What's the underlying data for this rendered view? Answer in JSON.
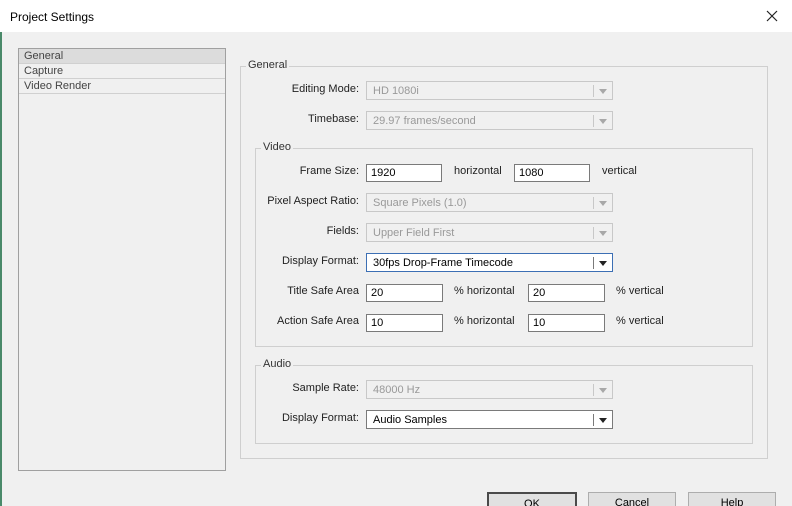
{
  "window": {
    "title": "Project Settings"
  },
  "sidebar": {
    "items": [
      {
        "label": "General"
      },
      {
        "label": "Capture"
      },
      {
        "label": "Video Render"
      }
    ]
  },
  "general": {
    "group_label": "General",
    "editing_mode": {
      "label": "Editing Mode:",
      "value": "HD 1080i"
    },
    "timebase": {
      "label": "Timebase:",
      "value": "29.97 frames/second"
    }
  },
  "video": {
    "group_label": "Video",
    "frame_size": {
      "label": "Frame Size:",
      "width": "1920",
      "horizontal_label": "horizontal",
      "height": "1080",
      "vertical_label": "vertical"
    },
    "pixel_aspect": {
      "label": "Pixel Aspect Ratio:",
      "value": "Square Pixels (1.0)"
    },
    "fields": {
      "label": "Fields:",
      "value": "Upper Field First"
    },
    "display_format": {
      "label": "Display Format:",
      "value": "30fps Drop-Frame Timecode"
    },
    "title_safe": {
      "label": "Title Safe Area",
      "h": "20",
      "h_label": "% horizontal",
      "v": "20",
      "v_label": "% vertical"
    },
    "action_safe": {
      "label": "Action Safe Area",
      "h": "10",
      "h_label": "% horizontal",
      "v": "10",
      "v_label": "% vertical"
    }
  },
  "audio": {
    "group_label": "Audio",
    "sample_rate": {
      "label": "Sample Rate:",
      "value": "48000 Hz"
    },
    "display_format": {
      "label": "Display Format:",
      "value": "Audio Samples"
    }
  },
  "buttons": {
    "ok": "OK",
    "cancel": "Cancel",
    "help": "Help"
  }
}
